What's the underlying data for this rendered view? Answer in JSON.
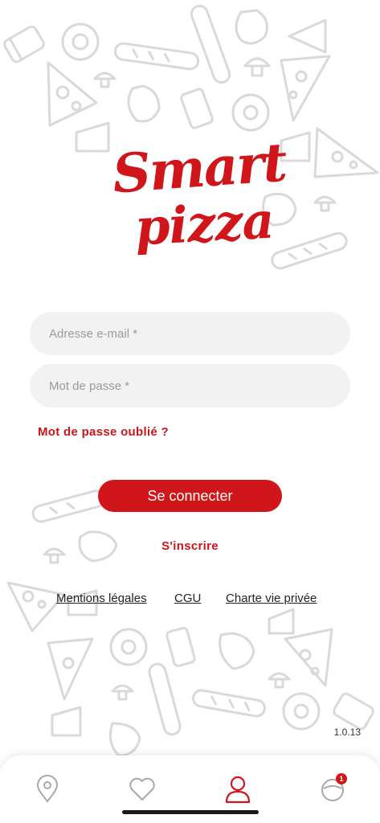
{
  "brand": {
    "line1": "Smart",
    "line2": "pizza",
    "color": "#d0161b"
  },
  "form": {
    "email_placeholder": "Adresse e-mail *",
    "password_placeholder": "Mot de passe *",
    "forgot_label": "Mot de passe oublié ?",
    "login_label": "Se connecter",
    "signup_label": "S'inscrire"
  },
  "legal_links": {
    "mentions": "Mentions légales",
    "cgu": "CGU",
    "privacy": "Charte vie privée"
  },
  "version": "1.0.13",
  "tabbar": {
    "items": [
      {
        "icon": "location-pin-icon",
        "active": false
      },
      {
        "icon": "heart-icon",
        "active": false
      },
      {
        "icon": "user-icon",
        "active": true
      },
      {
        "icon": "cart-bag-icon",
        "active": false,
        "badge": "1"
      }
    ]
  }
}
